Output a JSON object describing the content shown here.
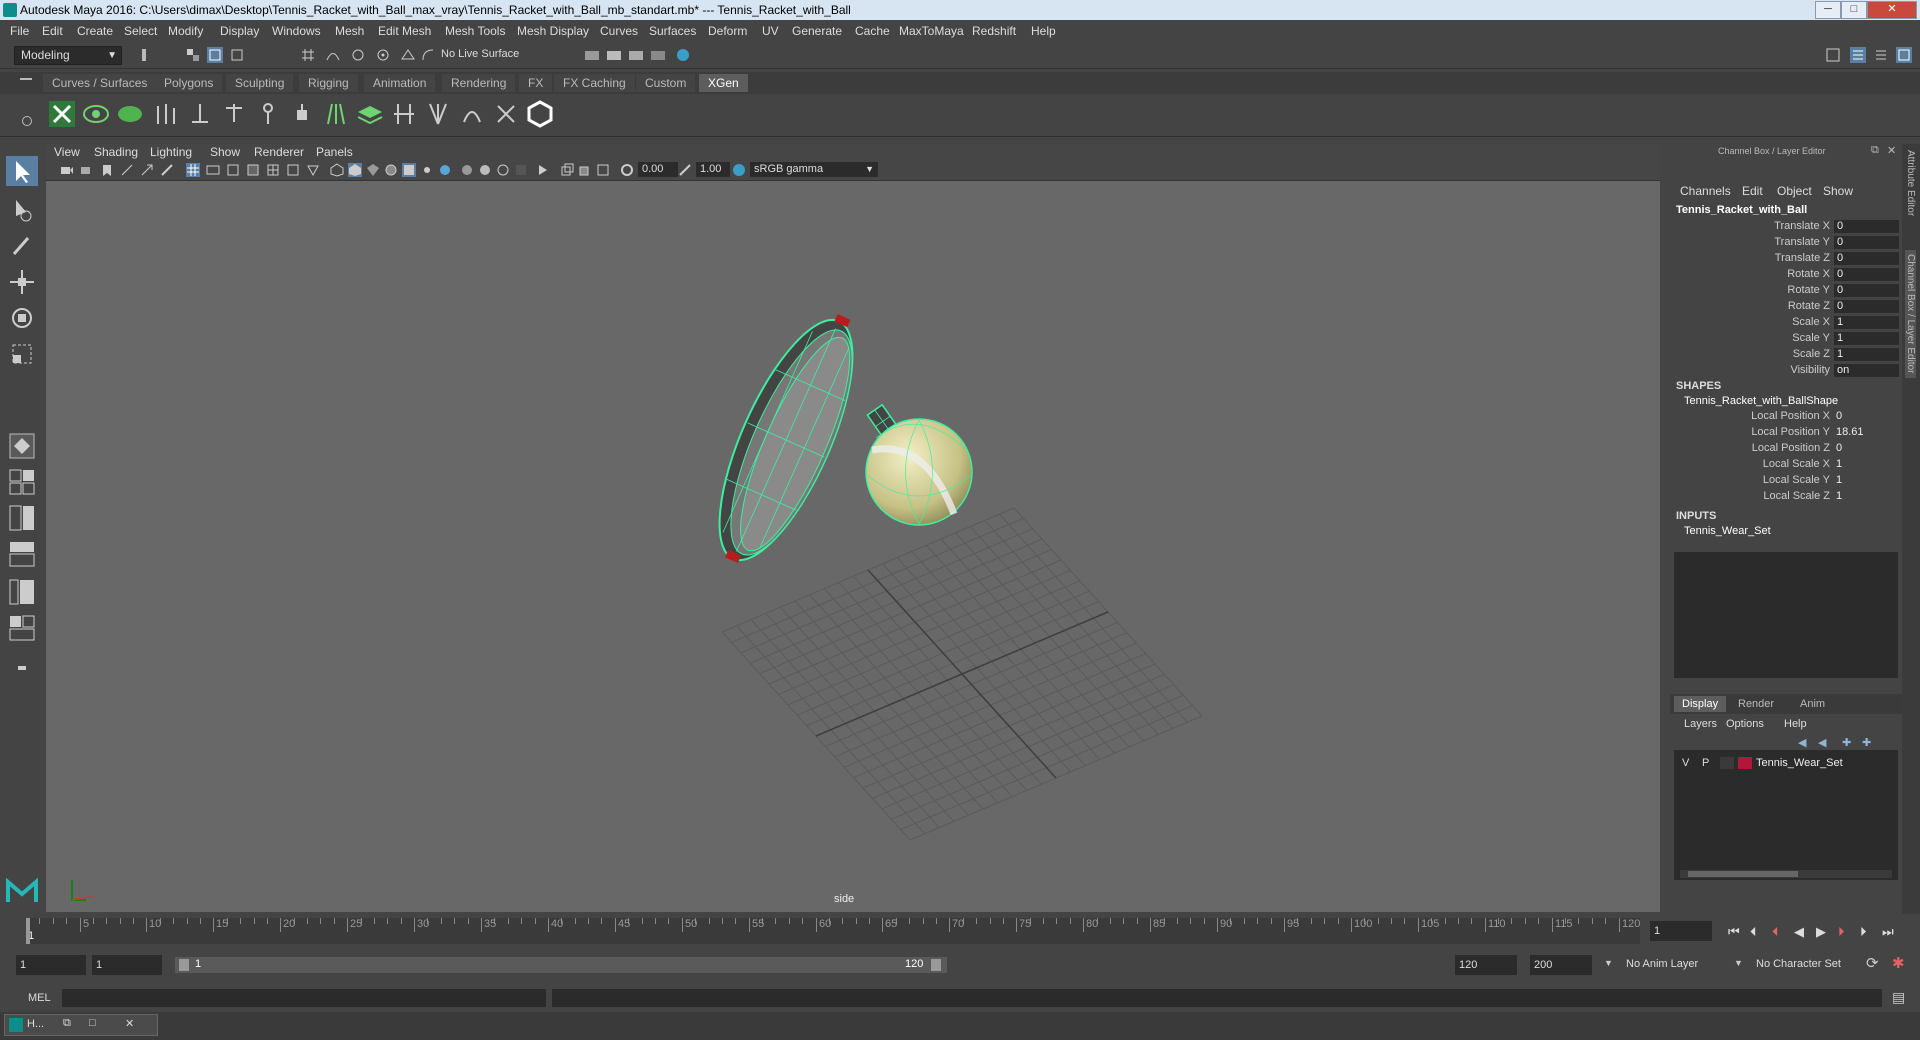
{
  "window": {
    "title": "Autodesk Maya 2016: C:\\Users\\dimax\\Desktop\\Tennis_Racket_with_Ball_max_vray\\Tennis_Racket_with_Ball_mb_standart.mb*   ---   Tennis_Racket_with_Ball",
    "minimize": "─",
    "maximize": "□",
    "close": "✕"
  },
  "menubar": [
    "File",
    "Edit",
    "Create",
    "Select",
    "Modify",
    "Display",
    "Windows",
    "Mesh",
    "Edit Mesh",
    "Mesh Tools",
    "Mesh Display",
    "Curves",
    "Surfaces",
    "Deform",
    "UV",
    "Generate",
    "Cache",
    "MaxToMaya",
    "Redshift",
    "Help"
  ],
  "statusline": {
    "mode": "Modeling",
    "live_surface": "No Live Surface"
  },
  "shelf_tabs": [
    "Curves / Surfaces",
    "Polygons",
    "Sculpting",
    "Rigging",
    "Animation",
    "Rendering",
    "FX",
    "FX Caching",
    "Custom",
    "XGen"
  ],
  "shelf_active": "XGen",
  "viewport": {
    "menu": [
      "View",
      "Shading",
      "Lighting",
      "Show",
      "Renderer",
      "Panels"
    ],
    "exposure": "0.00",
    "gamma": "1.00",
    "color_space": "sRGB gamma",
    "camera_label": "side"
  },
  "channel_box": {
    "title": "Channel Box / Layer Editor",
    "menu": [
      "Channels",
      "Edit",
      "Object",
      "Show"
    ],
    "object_name": "Tennis_Racket_with_Ball",
    "channels": [
      {
        "label": "Translate X",
        "value": "0"
      },
      {
        "label": "Translate Y",
        "value": "0"
      },
      {
        "label": "Translate Z",
        "value": "0"
      },
      {
        "label": "Rotate X",
        "value": "0"
      },
      {
        "label": "Rotate Y",
        "value": "0"
      },
      {
        "label": "Rotate Z",
        "value": "0"
      },
      {
        "label": "Scale X",
        "value": "1"
      },
      {
        "label": "Scale Y",
        "value": "1"
      },
      {
        "label": "Scale Z",
        "value": "1"
      },
      {
        "label": "Visibility",
        "value": "on"
      }
    ],
    "shapes_header": "SHAPES",
    "shape_name": "Tennis_Racket_with_BallShape",
    "shape_channels": [
      {
        "label": "Local Position X",
        "value": "0"
      },
      {
        "label": "Local Position Y",
        "value": "18.61"
      },
      {
        "label": "Local Position Z",
        "value": "0"
      },
      {
        "label": "Local Scale X",
        "value": "1"
      },
      {
        "label": "Local Scale Y",
        "value": "1"
      },
      {
        "label": "Local Scale Z",
        "value": "1"
      }
    ],
    "inputs_header": "INPUTS",
    "input_name": "Tennis_Wear_Set"
  },
  "layer_editor": {
    "tabs": [
      "Display",
      "Render",
      "Anim"
    ],
    "active_tab": "Display",
    "menu": [
      "Layers",
      "Options",
      "Help"
    ],
    "layer": {
      "v": "V",
      "p": "P",
      "name": "Tennis_Wear_Set",
      "color": "#b0183a"
    }
  },
  "side_tabs": [
    "Attribute Editor",
    "Channel Box / Layer Editor"
  ],
  "timeline": {
    "ticks": [
      "5",
      "10",
      "15",
      "20",
      "25",
      "30",
      "35",
      "40",
      "45",
      "50",
      "55",
      "60",
      "65",
      "70",
      "75",
      "80",
      "85",
      "90",
      "95",
      "100",
      "105",
      "110",
      "115",
      "120"
    ],
    "start_label": "1",
    "current_frame": "1"
  },
  "range": {
    "start": "1",
    "anim_start": "1",
    "range_start": "1",
    "range_end": "120",
    "end": "120",
    "anim_end": "200",
    "anim_layer": "No Anim Layer",
    "char_set": "No Character Set"
  },
  "cmdline": {
    "label": "MEL"
  },
  "taskbar": {
    "item": "H..."
  },
  "colors": {
    "accent": "#5ee8a8",
    "wire": "#3cf0a0",
    "ball": "#d8d49a",
    "layer": "#b0183a"
  }
}
